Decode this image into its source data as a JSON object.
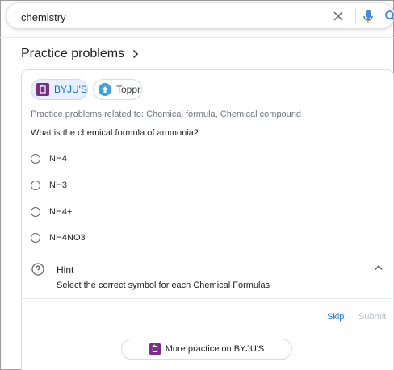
{
  "search": {
    "query": "chemistry"
  },
  "section": {
    "title": "Practice problems"
  },
  "sources": [
    {
      "label": "BYJU'S",
      "icon": "byjus-logo-icon",
      "selected": true
    },
    {
      "label": "Toppr",
      "icon": "toppr-logo-icon",
      "selected": false
    }
  ],
  "problem": {
    "related": "Practice problems related to: Chemical formula, Chemical compound",
    "question": "What is the chemical formula of ammonia?",
    "options": [
      "NH4",
      "NH3",
      "NH4+",
      "NH4NO3"
    ]
  },
  "hint": {
    "title": "Hint",
    "text": "Select the correct symbol for each Chemical Formulas"
  },
  "actions": {
    "skip": "Skip",
    "submit": "Submit",
    "more_practice": "More practice on BYJU'S"
  },
  "colors": {
    "accent": "#1a73e8",
    "byjus_purple": "#7b2d8e",
    "toppr_blue": "#3aa0e8"
  }
}
